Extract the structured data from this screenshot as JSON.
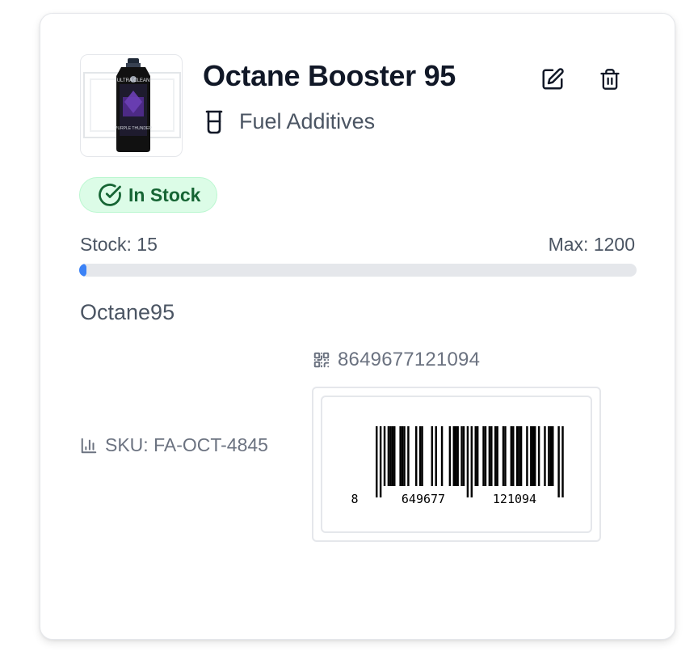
{
  "product": {
    "title": "Octane Booster 95",
    "category": "Fuel Additives",
    "category_icon": "beaker-icon",
    "status": "In Stock",
    "status_color": "#166534",
    "stock_label": "Stock: 15",
    "max_label": "Max: 1200",
    "stock": 15,
    "max": 1200,
    "name": "Octane95",
    "sku_label": "SKU: FA-OCT-4845",
    "barcode": "8649677121094",
    "barcode_text": {
      "first": "8",
      "left": "649677",
      "right": "121094"
    },
    "image_label": "ULTRA CLEAN",
    "image_sublabel": "PURPLE THUNDER"
  },
  "actions": {
    "edit_icon": "edit-icon",
    "delete_icon": "trash-icon"
  },
  "colors": {
    "progress": "#3b82f6",
    "badge_bg": "#dcfce7"
  }
}
